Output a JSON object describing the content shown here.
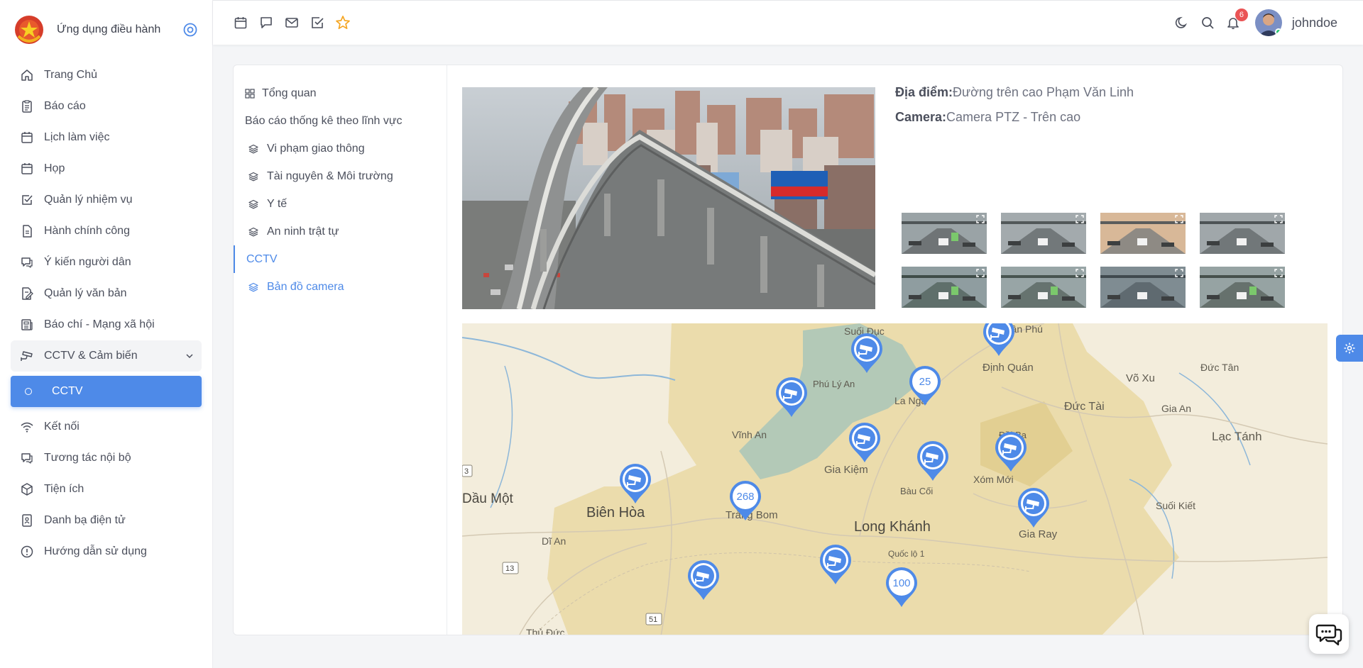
{
  "brand": {
    "name": "Ứng dụng điều hành"
  },
  "sidebar": {
    "items": [
      {
        "label": "Trang Chủ",
        "icon": "home-icon"
      },
      {
        "label": "Báo cáo",
        "icon": "clipboard-icon"
      },
      {
        "label": "Lịch làm việc",
        "icon": "calendar-icon"
      },
      {
        "label": "Họp",
        "icon": "calendar-icon"
      },
      {
        "label": "Quản lý nhiệm vụ",
        "icon": "check-square-icon"
      },
      {
        "label": "Hành chính công",
        "icon": "file-icon"
      },
      {
        "label": "Ý kiến người dân",
        "icon": "chat-icon"
      },
      {
        "label": "Quản lý văn bản",
        "icon": "file-edit-icon"
      },
      {
        "label": "Báo chí - Mạng xã hội",
        "icon": "newspaper-icon"
      },
      {
        "label": "CCTV & Cảm biến",
        "icon": "cctv-icon"
      },
      {
        "label": "CCTV",
        "icon": "circle-icon"
      },
      {
        "label": "Kết nối",
        "icon": "wifi-icon"
      },
      {
        "label": "Tương tác nội bộ",
        "icon": "chat-icon"
      },
      {
        "label": "Tiện ích",
        "icon": "box-icon"
      },
      {
        "label": "Danh bạ điện tử",
        "icon": "contact-book-icon"
      },
      {
        "label": "Hướng dẫn sử dụng",
        "icon": "info-icon"
      }
    ]
  },
  "topbar": {
    "notifications_count": "6",
    "username": "johndoe"
  },
  "subnav": {
    "overview": "Tổng quan",
    "section_title": "Báo cáo thống kê theo lĩnh vực",
    "items": [
      "Vi phạm giao thông",
      "Tài nguyên & Môi trường",
      "Y tế",
      "An ninh trật tự"
    ],
    "current": "CCTV",
    "map_item": "Bản đồ camera"
  },
  "camera_info": {
    "location_label": "Địa điểm:",
    "location_value": "Đường trên cao Phạm Văn Linh",
    "camera_label": "Camera:",
    "camera_value": "Camera PTZ - Trên cao"
  },
  "map": {
    "places": [
      "Suối Đục",
      "Tân Phú",
      "Định Quán",
      "Võ Xu",
      "Đức Tân",
      "Đức Tài",
      "Gia An",
      "Phú Lý An",
      "La Ngà",
      "Lạc Tánh",
      "Vĩnh An",
      "Đồi Ba",
      "Gia Kiệm",
      "Xóm Mới",
      "Bàu Cối",
      "Dầu Một",
      "Biên Hòa",
      "Trảng Bom",
      "Long Khánh",
      "Gia Ray",
      "Suối Kiết",
      "Dĩ An",
      "Quốc lộ 1",
      "Thủ Đức"
    ],
    "road_numbers": [
      "3",
      "13",
      "51"
    ],
    "clusters": [
      "25",
      "268",
      "100"
    ]
  },
  "colors": {
    "accent": "#4e8ae8",
    "badge": "#ea5455",
    "star": "#f5a623"
  }
}
